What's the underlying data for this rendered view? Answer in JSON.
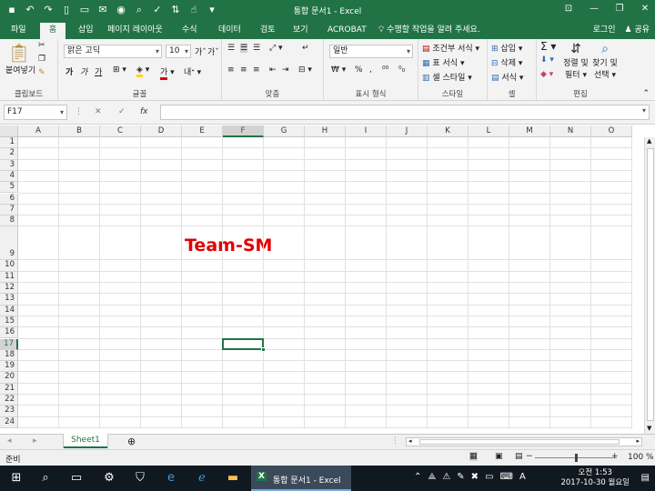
{
  "window": {
    "title": "통합 문서1 - Excel"
  },
  "qat_icons": [
    "save-icon",
    "undo-icon",
    "redo-icon",
    "new-icon",
    "open-icon",
    "mail-icon",
    "camera-icon",
    "print-preview-icon",
    "spellcheck-icon",
    "sort-icon",
    "touch-icon",
    "customize-icon"
  ],
  "tabs": [
    {
      "label": "파일"
    },
    {
      "label": "홈"
    },
    {
      "label": "삽입"
    },
    {
      "label": "페이지 레이아웃"
    },
    {
      "label": "수식"
    },
    {
      "label": "데이터"
    },
    {
      "label": "검토"
    },
    {
      "label": "보기"
    },
    {
      "label": "ACROBAT"
    }
  ],
  "tell_me": "수행할 작업을 알려 주세요.",
  "account": {
    "signin": "로그인",
    "share": "공유"
  },
  "ribbon": {
    "clipboard": {
      "label": "클립보드",
      "paste": "붙여넣기"
    },
    "font": {
      "label": "글꼴",
      "font_name": "맑은 고딕",
      "font_size": "10",
      "bold": "가",
      "italic": "가",
      "underline": "가"
    },
    "alignment": {
      "label": "맞춤"
    },
    "number": {
      "label": "표시 형식",
      "format": "일반",
      "percent": "%",
      "comma": ","
    },
    "styles": {
      "label": "스타일",
      "conditional": "조건부 서식",
      "table": "표 서식",
      "cell_styles": "셀 스타일"
    },
    "cells": {
      "label": "셀",
      "insert": "삽입",
      "delete": "삭제",
      "format": "서식"
    },
    "editing": {
      "label": "편집",
      "sort_filter_1": "정렬 및",
      "sort_filter_2": "필터",
      "find_1": "찾기 및",
      "find_2": "선택"
    }
  },
  "formula_bar": {
    "name_box": "F17",
    "fx": "fx",
    "content": ""
  },
  "columns": [
    "A",
    "B",
    "C",
    "D",
    "E",
    "F",
    "G",
    "H",
    "I",
    "J",
    "K",
    "L",
    "M",
    "N",
    "O"
  ],
  "rows": [
    "1",
    "2",
    "3",
    "4",
    "5",
    "6",
    "7",
    "8",
    "9",
    "10",
    "11",
    "12",
    "13",
    "14",
    "15",
    "16",
    "17",
    "18",
    "19",
    "20",
    "21",
    "22",
    "23",
    "24"
  ],
  "selected": {
    "column": "F",
    "row": "17"
  },
  "cell_text": {
    "E9": "Team-SM"
  },
  "colors": {
    "accent": "#217346",
    "team_text": "#e00000"
  },
  "sheets": [
    {
      "label": "Sheet1"
    }
  ],
  "status": {
    "ready": "준비",
    "zoom": "100 %"
  },
  "taskbar": {
    "excel_label": "통합 문서1 - Excel",
    "time": "오전 1:53",
    "date": "2017-10-30 월요일",
    "ime": "A"
  }
}
